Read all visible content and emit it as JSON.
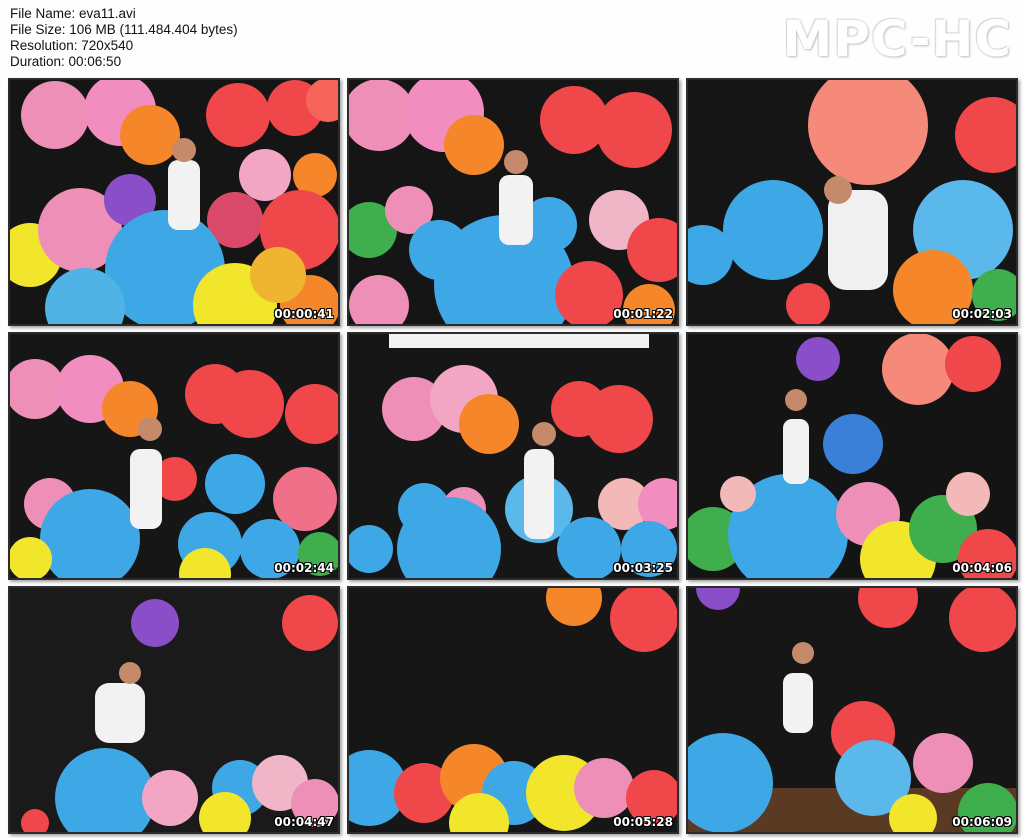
{
  "file_info": {
    "file_name": "File Name: eva11.avi",
    "file_size": "File Size: 106 MB (111.484.404 bytes)",
    "resolution": "Resolution: 720x540",
    "duration": "Duration: 00:06:50"
  },
  "logo": "MPC-HC",
  "colors": {
    "background": "#fefefe",
    "curtain": "#161616",
    "balloon_red": "#f0474a",
    "balloon_pink": "#f08ab0",
    "balloon_blue": "#3ea8e6",
    "balloon_yellow": "#f2e62c",
    "balloon_orange": "#f5862a",
    "balloon_green": "#3fae4c",
    "balloon_purple": "#8a4ec8"
  },
  "thumbnails": [
    {
      "timestamp": "00:00:41"
    },
    {
      "timestamp": "00:01:22"
    },
    {
      "timestamp": "00:02:03"
    },
    {
      "timestamp": "00:02:44"
    },
    {
      "timestamp": "00:03:25"
    },
    {
      "timestamp": "00:04:06"
    },
    {
      "timestamp": "00:04:47"
    },
    {
      "timestamp": "00:05:28"
    },
    {
      "timestamp": "00:06:09"
    }
  ]
}
